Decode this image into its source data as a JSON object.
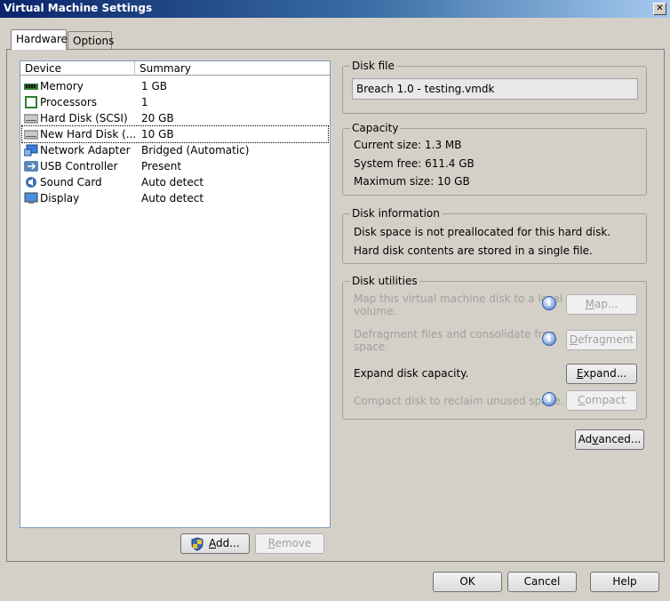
{
  "window": {
    "title": "Virtual Machine Settings",
    "close_glyph": "✕"
  },
  "tabs": [
    {
      "label": "Hardware",
      "active": true
    },
    {
      "label": "Options",
      "active": false
    }
  ],
  "device_list": {
    "headers": {
      "device": "Device",
      "summary": "Summary"
    },
    "rows": [
      {
        "icon": "memory-icon",
        "name": "Memory",
        "summary": "1 GB"
      },
      {
        "icon": "processor-icon",
        "name": "Processors",
        "summary": "1"
      },
      {
        "icon": "hard-disk-icon",
        "name": "Hard Disk (SCSI)",
        "summary": "20 GB"
      },
      {
        "icon": "hard-disk-icon",
        "name": "New Hard Disk (...",
        "summary": "10 GB",
        "selected": true
      },
      {
        "icon": "network-adapter-icon",
        "name": "Network Adapter",
        "summary": "Bridged (Automatic)"
      },
      {
        "icon": "usb-icon",
        "name": "USB Controller",
        "summary": "Present"
      },
      {
        "icon": "sound-card-icon",
        "name": "Sound Card",
        "summary": "Auto detect"
      },
      {
        "icon": "display-icon",
        "name": "Display",
        "summary": "Auto detect"
      }
    ]
  },
  "buttons": {
    "add": {
      "label_pre": "",
      "label_accel": "A",
      "label_post": "dd..."
    },
    "remove": {
      "label_pre": "",
      "label_accel": "R",
      "label_post": "emove"
    },
    "map": {
      "label_pre": "",
      "label_accel": "M",
      "label_post": "ap..."
    },
    "defragment": {
      "label_pre": "",
      "label_accel": "D",
      "label_post": "efragment"
    },
    "expand": {
      "label_pre": "",
      "label_accel": "E",
      "label_post": "xpand..."
    },
    "compact": {
      "label_pre": "",
      "label_accel": "C",
      "label_post": "ompact"
    },
    "advanced": {
      "label_pre": "Ad",
      "label_accel": "v",
      "label_post": "anced..."
    },
    "ok": "OK",
    "cancel": "Cancel",
    "help": "Help"
  },
  "disk_file": {
    "label": "Disk file",
    "value": "Breach 1.0 - testing.vmdk"
  },
  "capacity": {
    "label": "Capacity",
    "current": "Current size: 1.3 MB",
    "system_free": "System free: 611.4 GB",
    "maximum": "Maximum size: 10 GB"
  },
  "disk_information": {
    "label": "Disk information",
    "line1": "Disk space is not preallocated for this hard disk.",
    "line2": "Hard disk contents are stored in a single file."
  },
  "disk_utilities": {
    "label": "Disk utilities",
    "map_line1": "Map this virtual machine disk to a local",
    "map_line2": "volume.",
    "defrag_line1": "Defragment files and consolidate free",
    "defrag_line2": "space.",
    "expand_text": "Expand disk capacity.",
    "compact_text": "Compact disk to reclaim unused space.",
    "info_glyph": "i"
  }
}
